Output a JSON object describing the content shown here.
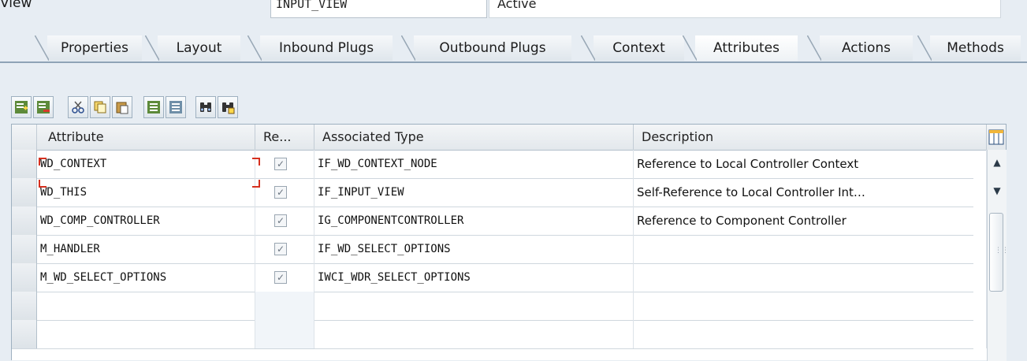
{
  "header": {
    "view_label": "View",
    "view_name": "INPUT_VIEW",
    "status": "Active"
  },
  "tabs": [
    {
      "label": "Properties"
    },
    {
      "label": "Layout"
    },
    {
      "label": "Inbound Plugs"
    },
    {
      "label": "Outbound Plugs"
    },
    {
      "label": "Context"
    },
    {
      "label": "Attributes"
    },
    {
      "label": "Actions"
    },
    {
      "label": "Methods"
    }
  ],
  "active_tab": "Attributes",
  "toolbar": {
    "icons": [
      "insert-row-icon",
      "delete-row-icon",
      "cut-icon",
      "copy-icon",
      "paste-icon",
      "details-icon",
      "details-alt-icon",
      "find-icon",
      "find-next-icon"
    ]
  },
  "table": {
    "columns": [
      "Attribute",
      "Re...",
      "Associated Type",
      "Description"
    ],
    "rows": [
      {
        "attribute": "WD_CONTEXT",
        "ref_to": "✓",
        "type": "IF_WD_CONTEXT_NODE",
        "description": "Reference to Local Controller Context"
      },
      {
        "attribute": "WD_THIS",
        "ref_to": "✓",
        "type": "IF_INPUT_VIEW",
        "description": "Self-Reference to Local Controller Int…"
      },
      {
        "attribute": "WD_COMP_CONTROLLER",
        "ref_to": "✓",
        "type": "IG_COMPONENTCONTROLLER",
        "description": "Reference to Component Controller"
      },
      {
        "attribute": "M_HANDLER",
        "ref_to": "✓",
        "type": "IF_WD_SELECT_OPTIONS",
        "description": ""
      },
      {
        "attribute": "M_WD_SELECT_OPTIONS",
        "ref_to": "✓",
        "type": "IWCI_WDR_SELECT_OPTIONS",
        "description": ""
      },
      {
        "attribute": "",
        "ref_to": "",
        "type": "",
        "description": ""
      },
      {
        "attribute": "",
        "ref_to": "",
        "type": "",
        "description": ""
      }
    ]
  },
  "colors": {
    "background": "#e7edf3",
    "focus": "#d6301f",
    "grid_border": "#9eb0c0"
  }
}
